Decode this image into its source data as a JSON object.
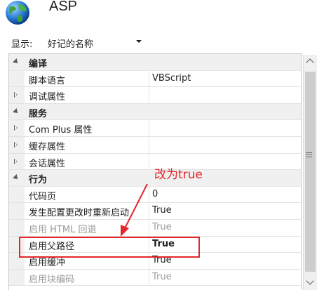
{
  "header": {
    "title": "ASP",
    "icon": "globe-icon"
  },
  "toolbar": {
    "show_label": "显示:",
    "sort_value": "好记的名称"
  },
  "grid": {
    "rows": [
      {
        "type": "cat",
        "expanded": true,
        "label": "编译"
      },
      {
        "type": "prop",
        "name": "脚本语言",
        "value": "VBScript"
      },
      {
        "type": "group",
        "name": "调试属性",
        "value": ""
      },
      {
        "type": "cat",
        "expanded": true,
        "label": "服务"
      },
      {
        "type": "group",
        "name": "Com Plus 属性",
        "value": ""
      },
      {
        "type": "group",
        "name": "缓存属性",
        "value": ""
      },
      {
        "type": "group",
        "name": "会话属性",
        "value": ""
      },
      {
        "type": "cat",
        "expanded": true,
        "label": "行为"
      },
      {
        "type": "prop",
        "name": "代码页",
        "value": "0"
      },
      {
        "type": "prop",
        "name": "发生配置更改时重新启动",
        "value": "True"
      },
      {
        "type": "prop",
        "name": "启用 HTML 回退",
        "value": "True",
        "dim": true
      },
      {
        "type": "prop",
        "name": "启用父路径",
        "value": "True",
        "bold": true
      },
      {
        "type": "prop",
        "name": "启用缓冲",
        "value": "True"
      },
      {
        "type": "prop",
        "name": "启用块编码",
        "value": "True",
        "dim": true
      }
    ]
  },
  "annotation": {
    "text": "改为true",
    "color": "#e5262b"
  }
}
